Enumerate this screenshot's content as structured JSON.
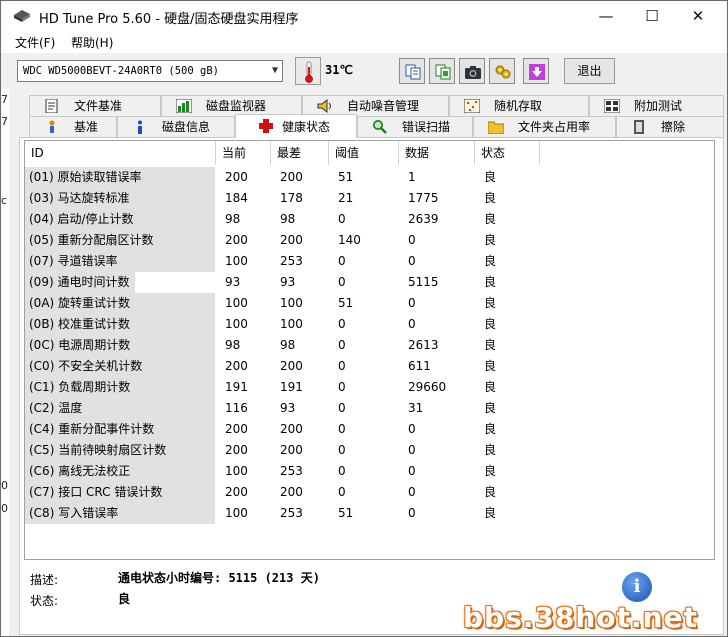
{
  "window": {
    "title": "HD Tune Pro 5.60 - 硬盘/固态硬盘实用程序",
    "controls": {
      "minimize": "—",
      "maximize": "☐",
      "close": "✕"
    }
  },
  "menu": {
    "items": [
      "文件(F)",
      "帮助(H)"
    ]
  },
  "toolbar": {
    "drive": "WDC WD5000BEVT-24A0RT0 (500 gB)",
    "temperature": "31℃",
    "icons": [
      "copy-text-icon",
      "copy-screenshot-icon",
      "camera-icon",
      "options-icon",
      "save-down-icon"
    ],
    "exit_label": "退出"
  },
  "left_strip": [
    "7",
    "7",
    "c",
    "0",
    "0"
  ],
  "tabs": {
    "top_row": [
      {
        "label": "文件基准",
        "icon": "file-benchmark-icon"
      },
      {
        "label": "磁盘监视器",
        "icon": "disk-monitor-icon"
      },
      {
        "label": "自动噪音管理",
        "icon": "speaker-icon"
      },
      {
        "label": "随机存取",
        "icon": "random-access-icon"
      },
      {
        "label": "附加测试",
        "icon": "extra-tests-icon"
      }
    ],
    "bottom_row": [
      {
        "label": "基准",
        "icon": "benchmark-icon"
      },
      {
        "label": "磁盘信息",
        "icon": "info-icon"
      },
      {
        "label": "健康状态",
        "icon": "health-cross-icon"
      },
      {
        "label": "错误扫描",
        "icon": "magnifier-icon"
      },
      {
        "label": "文件夹占用率",
        "icon": "folder-icon"
      },
      {
        "label": "擦除",
        "icon": "eraser-icon"
      }
    ],
    "active": "健康状态"
  },
  "table": {
    "headers": [
      "ID",
      "当前",
      "最差",
      "阈值",
      "数据",
      "状态"
    ],
    "rows": [
      [
        "(01) 原始读取错误率",
        "200",
        "200",
        "51",
        "1",
        "良"
      ],
      [
        "(03) 马达旋转标准",
        "184",
        "178",
        "21",
        "1775",
        "良"
      ],
      [
        "(04) 启动/停止计数",
        "98",
        "98",
        "0",
        "2639",
        "良"
      ],
      [
        "(05) 重新分配扇区计数",
        "200",
        "200",
        "140",
        "0",
        "良"
      ],
      [
        "(07) 寻道错误率",
        "100",
        "253",
        "0",
        "0",
        "良"
      ],
      [
        "(09) 通电时间计数",
        "93",
        "93",
        "0",
        "5115",
        "良"
      ],
      [
        "(0A) 旋转重试计数",
        "100",
        "100",
        "51",
        "0",
        "良"
      ],
      [
        "(0B) 校准重试计数",
        "100",
        "100",
        "0",
        "0",
        "良"
      ],
      [
        "(0C) 电源周期计数",
        "98",
        "98",
        "0",
        "2613",
        "良"
      ],
      [
        "(C0) 不安全关机计数",
        "200",
        "200",
        "0",
        "611",
        "良"
      ],
      [
        "(C1) 负载周期计数",
        "191",
        "191",
        "0",
        "29660",
        "良"
      ],
      [
        "(C2) 温度",
        "116",
        "93",
        "0",
        "31",
        "良"
      ],
      [
        "(C4) 重新分配事件计数",
        "200",
        "200",
        "0",
        "0",
        "良"
      ],
      [
        "(C5) 当前待映射扇区计数",
        "200",
        "200",
        "0",
        "0",
        "良"
      ],
      [
        "(C6) 离线无法校正",
        "100",
        "253",
        "0",
        "0",
        "良"
      ],
      [
        "(C7) 接口 CRC 错误计数",
        "200",
        "200",
        "0",
        "0",
        "良"
      ],
      [
        "(C8) 写入错误率",
        "100",
        "253",
        "51",
        "0",
        "良"
      ]
    ]
  },
  "details": {
    "desc_label": "描述:",
    "desc_value": "通电状态小时编号: 5115 (213 天)",
    "state_label": "状态:",
    "state_value": "良"
  },
  "watermark": "bbs.38hot.net"
}
